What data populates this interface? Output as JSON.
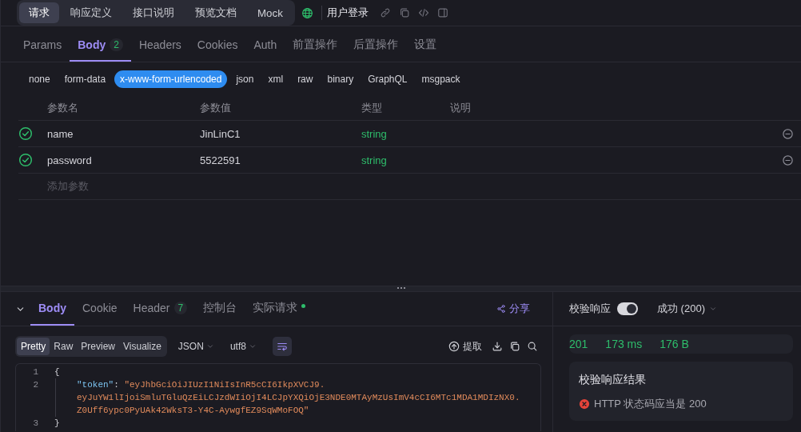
{
  "top_tabs": [
    {
      "label": "请求",
      "selected": true
    },
    {
      "label": "响应定义",
      "selected": false
    },
    {
      "label": "接口说明",
      "selected": false
    },
    {
      "label": "预览文档",
      "selected": false
    },
    {
      "label": "Mock",
      "selected": false
    }
  ],
  "endpoint": {
    "name": "用户登录"
  },
  "request_tabs": [
    {
      "label": "Params",
      "selected": false
    },
    {
      "label": "Body",
      "badge": "2",
      "selected": true
    },
    {
      "label": "Headers",
      "selected": false
    },
    {
      "label": "Cookies",
      "selected": false
    },
    {
      "label": "Auth",
      "selected": false
    },
    {
      "label": "前置操作",
      "selected": false
    },
    {
      "label": "后置操作",
      "selected": false
    },
    {
      "label": "设置",
      "selected": false
    }
  ],
  "body_types": [
    {
      "label": "none",
      "selected": false
    },
    {
      "label": "form-data",
      "selected": false
    },
    {
      "label": "x-www-form-urlencoded",
      "selected": true
    },
    {
      "label": "json",
      "selected": false
    },
    {
      "label": "xml",
      "selected": false
    },
    {
      "label": "raw",
      "selected": false
    },
    {
      "label": "binary",
      "selected": false
    },
    {
      "label": "GraphQL",
      "selected": false
    },
    {
      "label": "msgpack",
      "selected": false
    }
  ],
  "params_table": {
    "columns": [
      "参数名",
      "参数值",
      "类型",
      "说明"
    ],
    "rows": [
      {
        "enabled": true,
        "name": "name",
        "value": "JinLinC1",
        "type": "string"
      },
      {
        "enabled": true,
        "name": "password",
        "value": "5522591",
        "type": "string"
      }
    ],
    "add_placeholder": "添加参数"
  },
  "response": {
    "tabs": [
      {
        "label": "Body",
        "selected": true
      },
      {
        "label": "Cookie",
        "selected": false
      },
      {
        "label": "Header",
        "badge": "7",
        "selected": false
      },
      {
        "label": "控制台",
        "selected": false
      },
      {
        "label": "实际请求",
        "dot": true,
        "selected": false
      }
    ],
    "share": "分享",
    "views": [
      {
        "label": "Pretty",
        "selected": true
      },
      {
        "label": "Raw",
        "selected": false
      },
      {
        "label": "Preview",
        "selected": false
      },
      {
        "label": "Visualize",
        "selected": false
      }
    ],
    "format": "JSON",
    "encoding": "utf8",
    "extract": "提取",
    "code_lines": [
      {
        "number": "1",
        "kind": "brace",
        "text": "{"
      },
      {
        "number": "2",
        "kind": "pair",
        "key": "\"token\"",
        "separator": ": ",
        "value_lines": [
          "\"eyJhbGciOiJIUzI1NiIsInR5cCI6IkpXVCJ9.",
          "eyJuYW1lIjoiSmluTGluQzEiLCJzdWIiOjI4LCJpYXQiOjE3NDE0MTAyMzUsImV4cCI6MTc1MDA1MDIzNX0.",
          "Z0Uff6ypc0PyUAk42WksT3-Y4C-AywgfEZ9SqWMoFOQ\""
        ]
      },
      {
        "number": "3",
        "kind": "brace",
        "text": "}"
      }
    ]
  },
  "validation": {
    "label": "校验响应",
    "on": true,
    "status": "成功 (200)",
    "metrics": [
      "201",
      "173 ms",
      "176 B"
    ],
    "result_title": "校验响应结果",
    "results": [
      {
        "text": "HTTP 状态码应当是 200",
        "passed": false
      }
    ]
  }
}
